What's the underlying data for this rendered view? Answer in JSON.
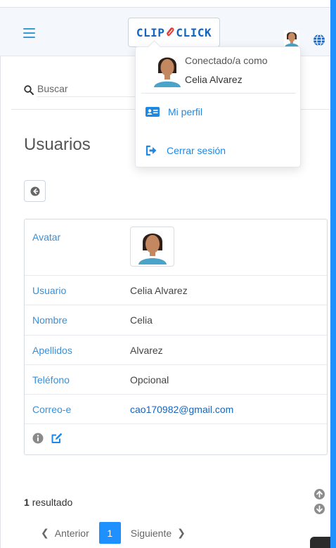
{
  "header": {
    "logo_left": "CLIP",
    "logo_right": "CLICK"
  },
  "search": {
    "placeholder": "Buscar"
  },
  "page": {
    "title": "Usuarios"
  },
  "detail": {
    "avatar_label": "Avatar",
    "rows": [
      {
        "label": "Usuario",
        "value": "Celia Alvarez"
      },
      {
        "label": "Nombre",
        "value": "Celia"
      },
      {
        "label": "Apellidos",
        "value": "Alvarez"
      },
      {
        "label": "Teléfono",
        "value": "Opcional"
      },
      {
        "label": "Correo-e",
        "value": "cao170982@gmail.com"
      }
    ]
  },
  "results": {
    "count": "1",
    "label": "resultado"
  },
  "pagination": {
    "prev": "Anterior",
    "current": "1",
    "next": "Siguiente"
  },
  "user_menu": {
    "connected_as": "Conectado/a como",
    "user_name": "Celia Alvarez",
    "profile": "Mi perfil",
    "logout": "Cerrar sesión"
  },
  "colors": {
    "accent": "#1e90ff",
    "label_blue": "#3a8fd6",
    "link_blue": "#1565c0",
    "logo_red": "#e53935"
  },
  "icons": [
    "menu-icon",
    "user-avatar-icon",
    "globe-icon",
    "search-icon",
    "arrow-left-icon",
    "info-icon",
    "edit-icon",
    "id-card-icon",
    "sign-out-icon",
    "arrow-up-icon",
    "arrow-down-icon"
  ]
}
